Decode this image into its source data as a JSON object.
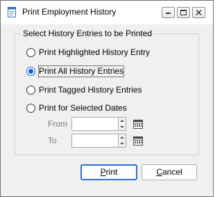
{
  "window": {
    "title": "Print Employment History",
    "controls": [
      "minimize-icon",
      "maximize-icon",
      "close-icon"
    ]
  },
  "group": {
    "legend": "Select History Entries to be Printed"
  },
  "options": [
    {
      "label": "Print Highlighted History Entry",
      "checked": false
    },
    {
      "label": "Print All History Entries",
      "checked": true
    },
    {
      "label": "Print Tagged History Entries",
      "checked": false
    },
    {
      "label": "Print for Selected Dates",
      "checked": false
    }
  ],
  "dates": {
    "from_label": "From",
    "from_value": "",
    "to_label": "To",
    "to_value": "",
    "calendar_icon": "calendar-icon"
  },
  "buttons": {
    "print_first": "P",
    "print_rest": "rint",
    "cancel_first": "C",
    "cancel_rest": "ancel"
  },
  "colors": {
    "accent": "#0b5fd0",
    "default_button_border": "#2f6fd6"
  }
}
